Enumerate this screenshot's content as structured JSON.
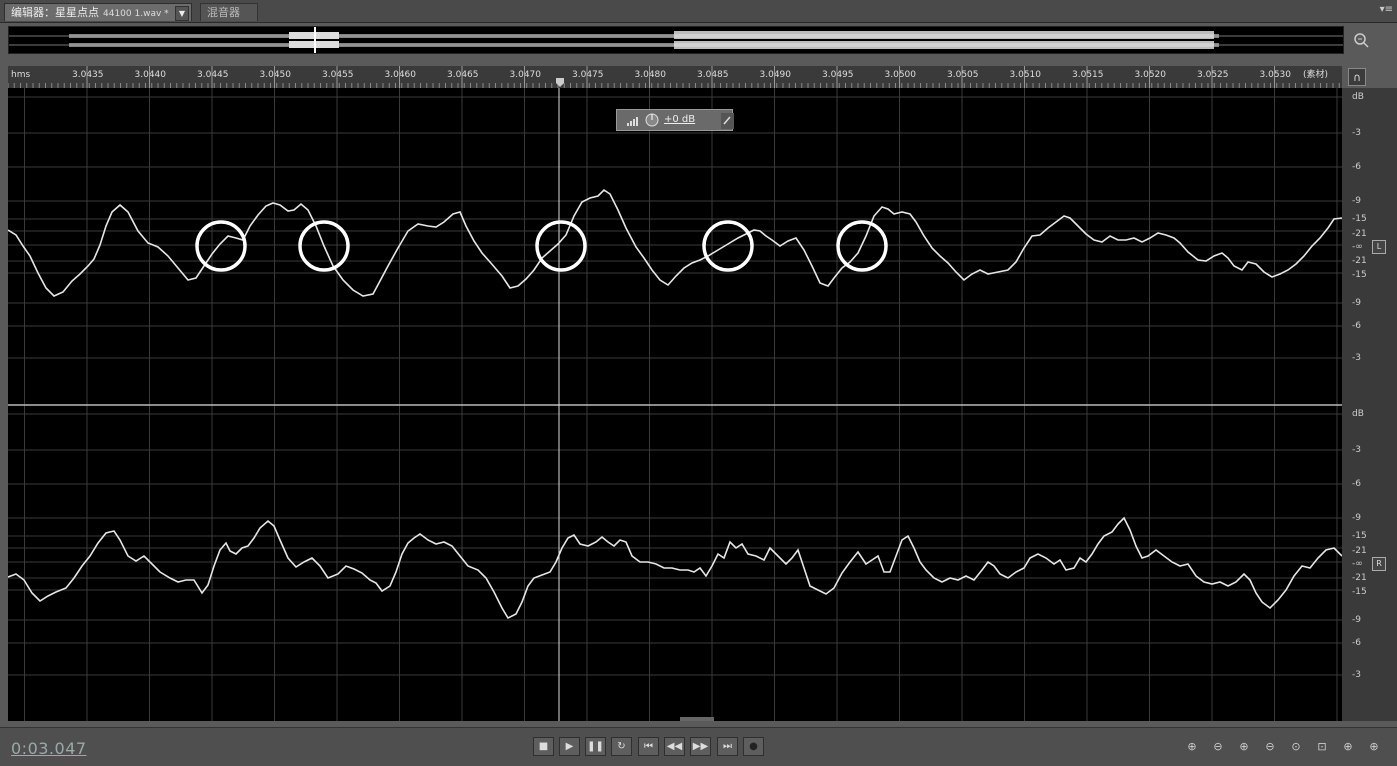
{
  "tabs": {
    "editor_label": "编辑器：星星点点",
    "editor_file": "44100  1.wav *",
    "mixer_label": "混音器"
  },
  "ruler": {
    "unit": "hms",
    "source_label": "(素材)",
    "ticks": [
      "3.0435",
      "3.0440",
      "3.0445",
      "3.0450",
      "3.0455",
      "3.0460",
      "3.0465",
      "3.0470",
      "3.0475",
      "3.0480",
      "3.0485",
      "3.0490",
      "3.0495",
      "3.0500",
      "3.0505",
      "3.0510",
      "3.0515",
      "3.0520",
      "3.0525",
      "3.0530"
    ]
  },
  "hud": {
    "gain_label": "+0 dB"
  },
  "channels": [
    {
      "label": "L",
      "scale": [
        "dB",
        "-3",
        "-6",
        "-9",
        "-15",
        "-21",
        "-∞",
        "-21",
        "-15",
        "-9",
        "-6",
        "-3"
      ]
    },
    {
      "label": "R",
      "scale": [
        "dB",
        "-3",
        "-6",
        "-9",
        "-15",
        "-21",
        "-∞",
        "-21",
        "-15",
        "-9",
        "-6",
        "-3"
      ]
    }
  ],
  "transport": {
    "timecode": "0:03.047",
    "buttons": [
      "stop-icon",
      "play-icon",
      "pause-icon",
      "loop-icon",
      "skip-start-icon",
      "rewind-icon",
      "fast-forward-icon",
      "skip-end-icon",
      "record-icon"
    ]
  },
  "zoom": {
    "buttons": [
      "zoom-in-amplitude-icon",
      "zoom-out-amplitude-icon",
      "zoom-in-time-icon",
      "zoom-out-time-icon",
      "zoom-full-icon",
      "zoom-selection-icon",
      "zoom-in-left-icon",
      "zoom-in-right-icon"
    ]
  },
  "annotations": {
    "circle_count": 5
  }
}
